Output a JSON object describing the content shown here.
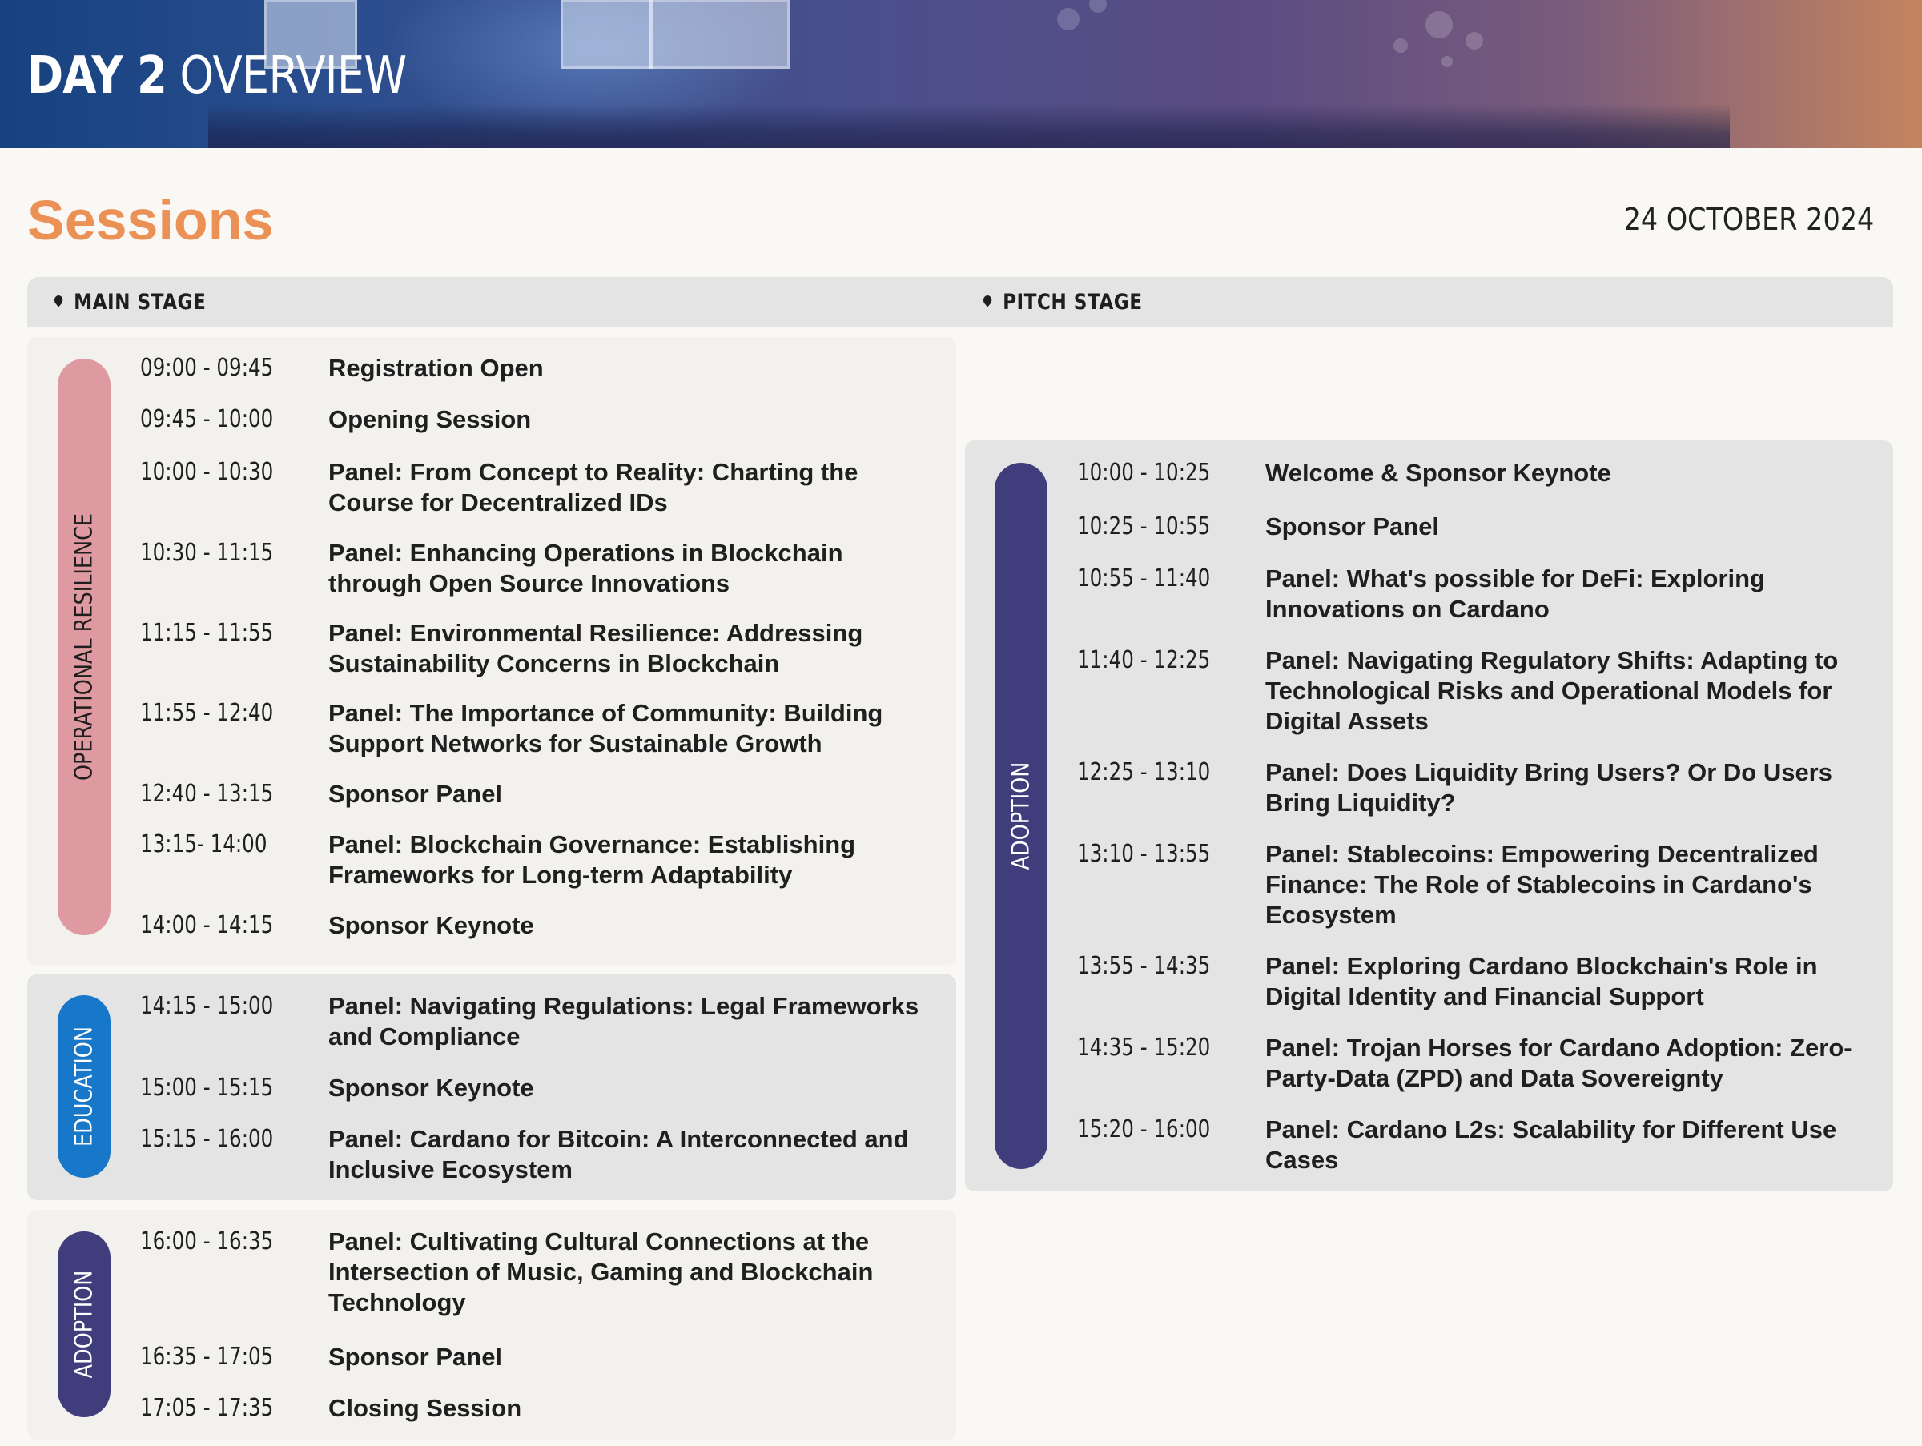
{
  "banner": {
    "title_bold": "DAY 2",
    "title_light": "OVERVIEW"
  },
  "heading": "Sessions",
  "date": "24 OCTOBER 2024",
  "colors": {
    "accent": "#eb9156",
    "resilience": "#df9aa1",
    "education": "#1777c9",
    "adoption": "#3f3d7c"
  },
  "stages": {
    "main": "MAIN STAGE",
    "pitch": "PITCH STAGE"
  },
  "main_stage": {
    "tracks": [
      {
        "label": "OPERATIONAL RESILIENCE",
        "sessions": [
          {
            "time": "09:00 - 09:45",
            "title": "Registration Open"
          },
          {
            "time": "09:45 - 10:00",
            "title": "Opening Session"
          },
          {
            "time": "10:00 - 10:30",
            "title": "Panel: From Concept to Reality: Charting the Course for Decentralized IDs"
          },
          {
            "time": "10:30 - 11:15",
            "title": "Panel: Enhancing Operations in Blockchain through Open Source Innovations"
          },
          {
            "time": "11:15 - 11:55",
            "title": "Panel: Environmental Resilience: Addressing Sustainability Concerns in Blockchain"
          },
          {
            "time": "11:55 - 12:40",
            "title": "Panel: The Importance of Community: Building Support Networks for Sustainable Growth"
          },
          {
            "time": "12:40 - 13:15",
            "title": "Sponsor Panel"
          },
          {
            "time": "13:15- 14:00",
            "title": "Panel: Blockchain Governance: Establishing Frameworks for Long-term Adaptability"
          },
          {
            "time": "14:00 - 14:15",
            "title": "Sponsor Keynote"
          }
        ]
      },
      {
        "label": "EDUCATION",
        "sessions": [
          {
            "time": "14:15 - 15:00",
            "title": "Panel: Navigating Regulations: Legal Frameworks and Compliance"
          },
          {
            "time": "15:00 - 15:15",
            "title": "Sponsor Keynote"
          },
          {
            "time": "15:15 - 16:00",
            "title": "Panel: Cardano for Bitcoin: A Interconnected and Inclusive Ecosystem"
          }
        ]
      },
      {
        "label": "ADOPTION",
        "sessions": [
          {
            "time": "16:00 - 16:35",
            "title": "Panel: Cultivating Cultural Connections at the Intersection of Music, Gaming and Blockchain Technology"
          },
          {
            "time": "16:35 - 17:05",
            "title": "Sponsor Panel"
          },
          {
            "time": "17:05 - 17:35",
            "title": "Closing Session"
          }
        ]
      }
    ]
  },
  "pitch_stage": {
    "tracks": [
      {
        "label": "ADOPTION",
        "sessions": [
          {
            "time": "10:00 - 10:25",
            "title": "Welcome & Sponsor Keynote"
          },
          {
            "time": "10:25 - 10:55",
            "title": "Sponsor Panel"
          },
          {
            "time": "10:55 - 11:40",
            "title": "Panel: What's possible for DeFi: Exploring Innovations on Cardano"
          },
          {
            "time": "11:40 - 12:25",
            "title": "Panel: Navigating Regulatory Shifts: Adapting to Technological Risks and Operational Models for Digital Assets"
          },
          {
            "time": "12:25 - 13:10",
            "title": "Panel: Does Liquidity Bring Users? Or Do Users Bring Liquidity?"
          },
          {
            "time": "13:10 - 13:55",
            "title": "Panel: Stablecoins: Empowering Decentralized Finance: The Role of Stablecoins in Cardano's Ecosystem"
          },
          {
            "time": "13:55 - 14:35",
            "title": "Panel: Exploring Cardano Blockchain's Role in Digital Identity and Financial Support"
          },
          {
            "time": "14:35 - 15:20",
            "title": "Panel: Trojan Horses for Cardano Adoption: Zero-Party-Data (ZPD) and Data Sovereignty"
          },
          {
            "time": "15:20 - 16:00",
            "title": "Panel: Cardano L2s: Scalability for Different Use Cases"
          }
        ]
      }
    ]
  }
}
